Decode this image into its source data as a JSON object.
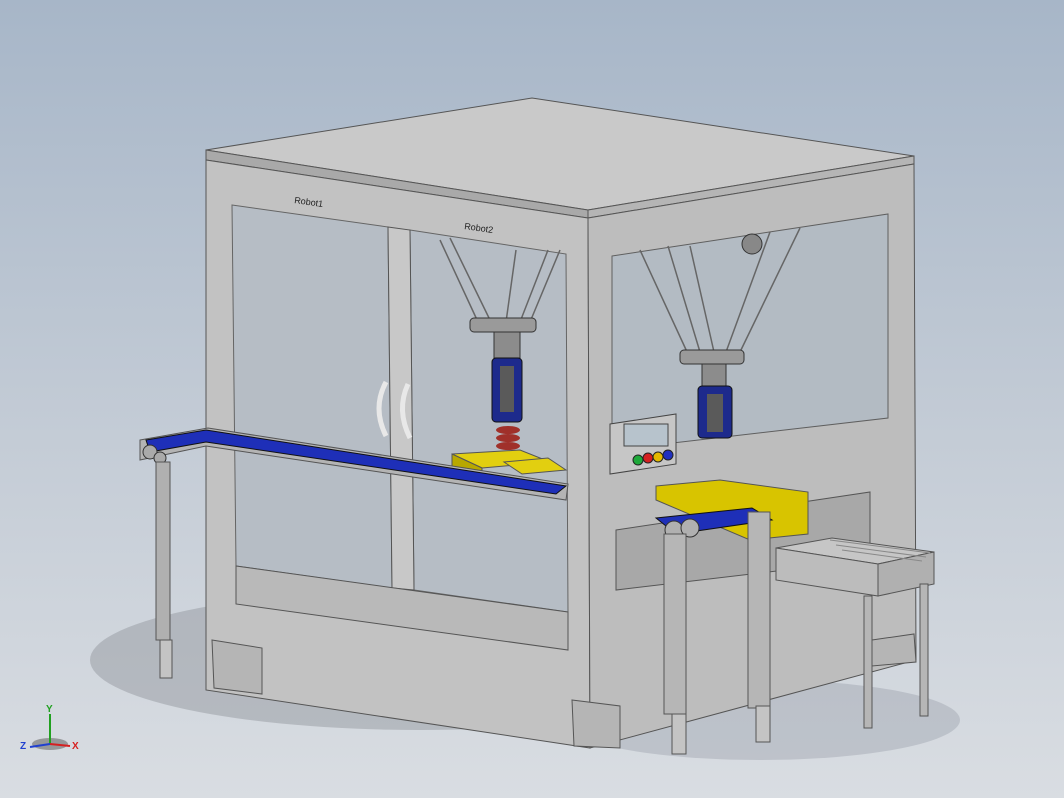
{
  "model": {
    "robot1_label": "Robot1",
    "robot2_label": "Robot2"
  },
  "triad": {
    "x_label": "X",
    "y_label": "Y",
    "z_label": "Z",
    "x_color": "#d62020",
    "y_color": "#20a020",
    "z_color": "#2040d0"
  },
  "colors": {
    "frame": "#c8c8c8",
    "frame_dark": "#9c9c9c",
    "conveyor_belt": "#1e2fb8",
    "tray": "#d8c400",
    "background_top": "#a7b6c8",
    "background_bottom": "#d9dde2"
  }
}
